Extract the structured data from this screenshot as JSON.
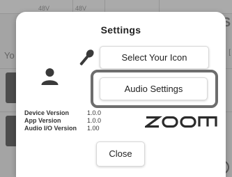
{
  "background": {
    "topbar_chips": [
      "48V",
      "48V"
    ],
    "left_text": "Yo",
    "right_glyph": "S"
  },
  "dialog": {
    "title": "Settings",
    "select_icon_label": "Select Your Icon",
    "audio_settings_label": "Audio Settings",
    "close_label": "Close",
    "versions": [
      {
        "label": "Device Version",
        "value": "1.0.0"
      },
      {
        "label": "App Version",
        "value": "1.0.0"
      },
      {
        "label": "Audio I/O Version",
        "value": "1.00"
      }
    ],
    "logo": "ZOOM"
  },
  "colors": {
    "dialog_bg": "#ffffff",
    "highlight_frame": "#6d6d6d",
    "icon": "#3a3a3a",
    "overlay": "rgba(0,0,0,0.28)"
  }
}
